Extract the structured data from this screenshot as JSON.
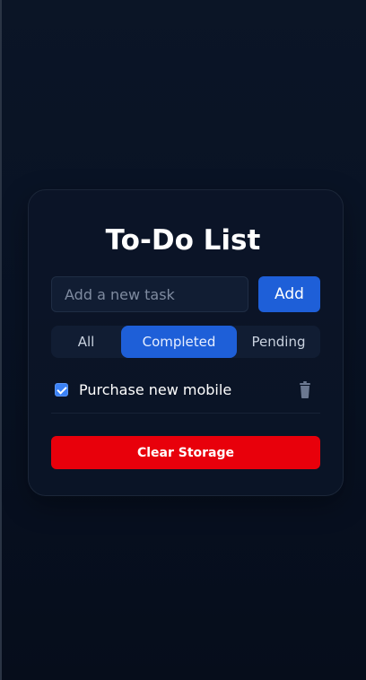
{
  "app": {
    "title": "To-Do List"
  },
  "new_task": {
    "placeholder": "Add a new task",
    "value": "",
    "add_label": "Add"
  },
  "filters": {
    "items": [
      {
        "label": "All",
        "active": false
      },
      {
        "label": "Completed",
        "active": true
      },
      {
        "label": "Pending",
        "active": false
      }
    ]
  },
  "tasks": [
    {
      "text": "Purchase new mobile",
      "completed": true,
      "delete_icon": "trash-icon"
    }
  ],
  "actions": {
    "clear_label": "Clear Storage"
  },
  "colors": {
    "accent": "#1e5fd8",
    "danger": "#e8000b",
    "background": "#081224"
  }
}
